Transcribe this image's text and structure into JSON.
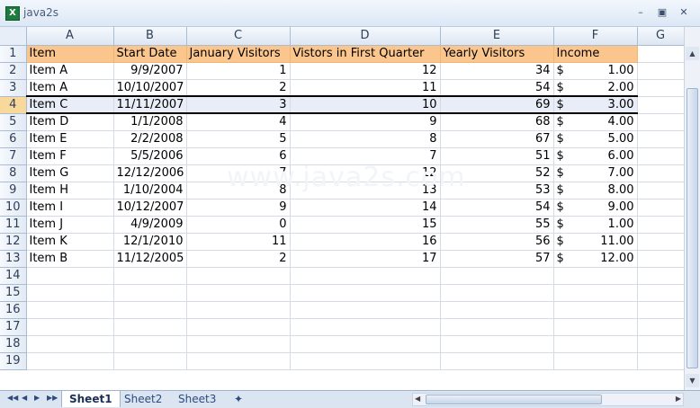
{
  "window": {
    "title": "java2s",
    "icon": "excel-icon"
  },
  "columns": [
    "A",
    "B",
    "C",
    "D",
    "E",
    "F",
    "G"
  ],
  "header": [
    "Item",
    "Start Date",
    "January Visitors",
    "Vistors in First Quarter",
    "Yearly Visitors",
    "Income"
  ],
  "rows": [
    [
      "Item A",
      "9/9/2007",
      "1",
      "12",
      "34",
      "1.00"
    ],
    [
      "Item A",
      "10/10/2007",
      "2",
      "11",
      "54",
      "2.00"
    ],
    [
      "Item C",
      "11/11/2007",
      "3",
      "10",
      "69",
      "3.00"
    ],
    [
      "Item D",
      "1/1/2008",
      "4",
      "9",
      "68",
      "4.00"
    ],
    [
      "Item E",
      "2/2/2008",
      "5",
      "8",
      "67",
      "5.00"
    ],
    [
      "Item F",
      "5/5/2006",
      "6",
      "7",
      "51",
      "6.00"
    ],
    [
      "Item G",
      "12/12/2006",
      "7",
      "12",
      "52",
      "7.00"
    ],
    [
      "Item H",
      "1/10/2004",
      "8",
      "13",
      "53",
      "8.00"
    ],
    [
      "Item I",
      "10/12/2007",
      "9",
      "14",
      "54",
      "9.00"
    ],
    [
      "Item J",
      "4/9/2009",
      "0",
      "15",
      "55",
      "1.00"
    ],
    [
      "Item K",
      "12/1/2010",
      "11",
      "16",
      "56",
      "11.00"
    ],
    [
      "Item B",
      "11/12/2005",
      "2",
      "17",
      "57",
      "12.00"
    ]
  ],
  "currency_symbol": "$",
  "row_numbers": [
    "1",
    "2",
    "3",
    "4",
    "5",
    "6",
    "7",
    "8",
    "9",
    "10",
    "11",
    "12",
    "13",
    "14",
    "15",
    "16",
    "17",
    "18",
    "19"
  ],
  "watermark": "www.java2s.com",
  "sheets": [
    "Sheet1",
    "Sheet2",
    "Sheet3"
  ],
  "active_sheet": "Sheet1",
  "colors": {
    "header_fill": "#fbc68d",
    "selected_row": "#e8edf7"
  }
}
